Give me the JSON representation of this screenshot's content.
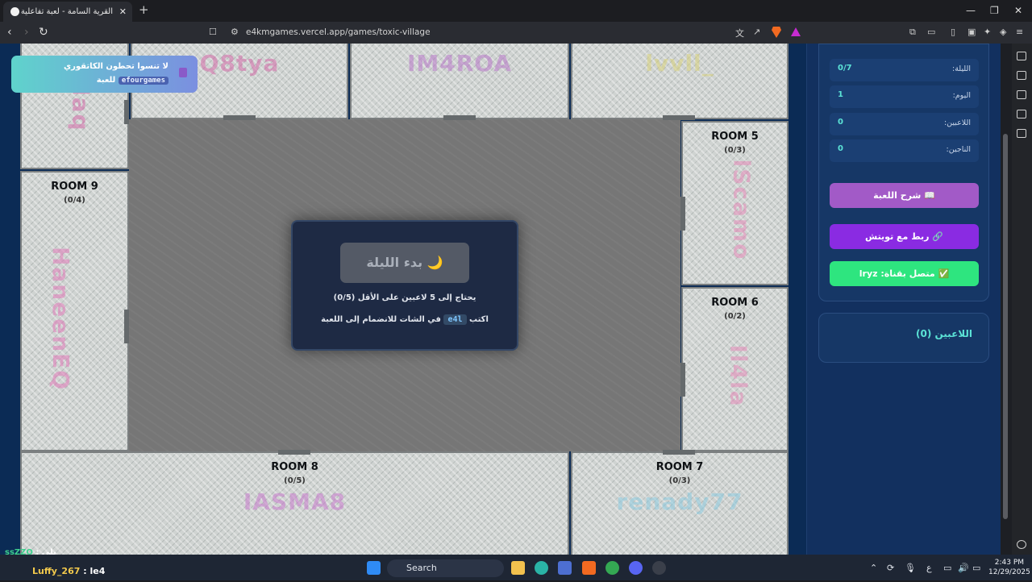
{
  "browser": {
    "tab_title": "القرية السامة - لعبة تفاعلية",
    "tab_close": "✕",
    "new_tab": "+",
    "url": "e4kmgames.vercel.app/games/toxic-village",
    "win_min": "—",
    "win_max": "❐",
    "win_close": "✕"
  },
  "banner": {
    "line1": "لا تنسوا تحطون الكاتقوري",
    "code": "efourgames",
    "line2_suffix": "للعبة"
  },
  "rooms": {
    "top1_name": "Q8tya",
    "top2_name": "IM4ROA",
    "top3_name": "lvvll_",
    "left_top_name": "llaq",
    "room9_title": "ROOM 9",
    "room9_count": "(0/4)",
    "room9_name": "HaneenEQ",
    "room5_title": "ROOM 5",
    "room5_count": "(0/3)",
    "room5_name": "lScamo",
    "room6_title": "ROOM 6",
    "room6_count": "(0/2)",
    "room6_name": "Il4la",
    "room8_title": "ROOM 8",
    "room8_count": "(0/5)",
    "room8_name": "IASMA8",
    "room7_title": "ROOM 7",
    "room7_count": "(0/3)",
    "room7_name": "renady77"
  },
  "modal": {
    "start_label": "بدء الليلة",
    "moon": "🌙",
    "need_text": "يحتاج إلى 5 لاعبين على الأقل (0/5)",
    "join_prefix": "اكتب",
    "join_code": "e4l",
    "join_suffix": "في الشات للانضمام إلى اللعبة"
  },
  "sidebar": {
    "stats": [
      {
        "label": "الليلة:",
        "value": "0/7"
      },
      {
        "label": "اليوم:",
        "value": "1"
      },
      {
        "label": "اللاعبين:",
        "value": "0"
      },
      {
        "label": "الناجين:",
        "value": "0"
      }
    ],
    "explain_btn": "📖 شرح اللعبة",
    "twitch_btn": "🔗 ربط مع تويتش",
    "connected_btn": "✅ متصل بقناة: lryz",
    "players_title": "اللاعبين (0)"
  },
  "chat": {
    "line1_user": "ssZZO",
    "line1_text": ": يلي",
    "line2_user": "Luffy_267",
    "line2_text": ": le4"
  },
  "taskbar": {
    "search": "Search",
    "lang": "ع",
    "time": "2:43 PM",
    "date": "12/29/2025"
  }
}
